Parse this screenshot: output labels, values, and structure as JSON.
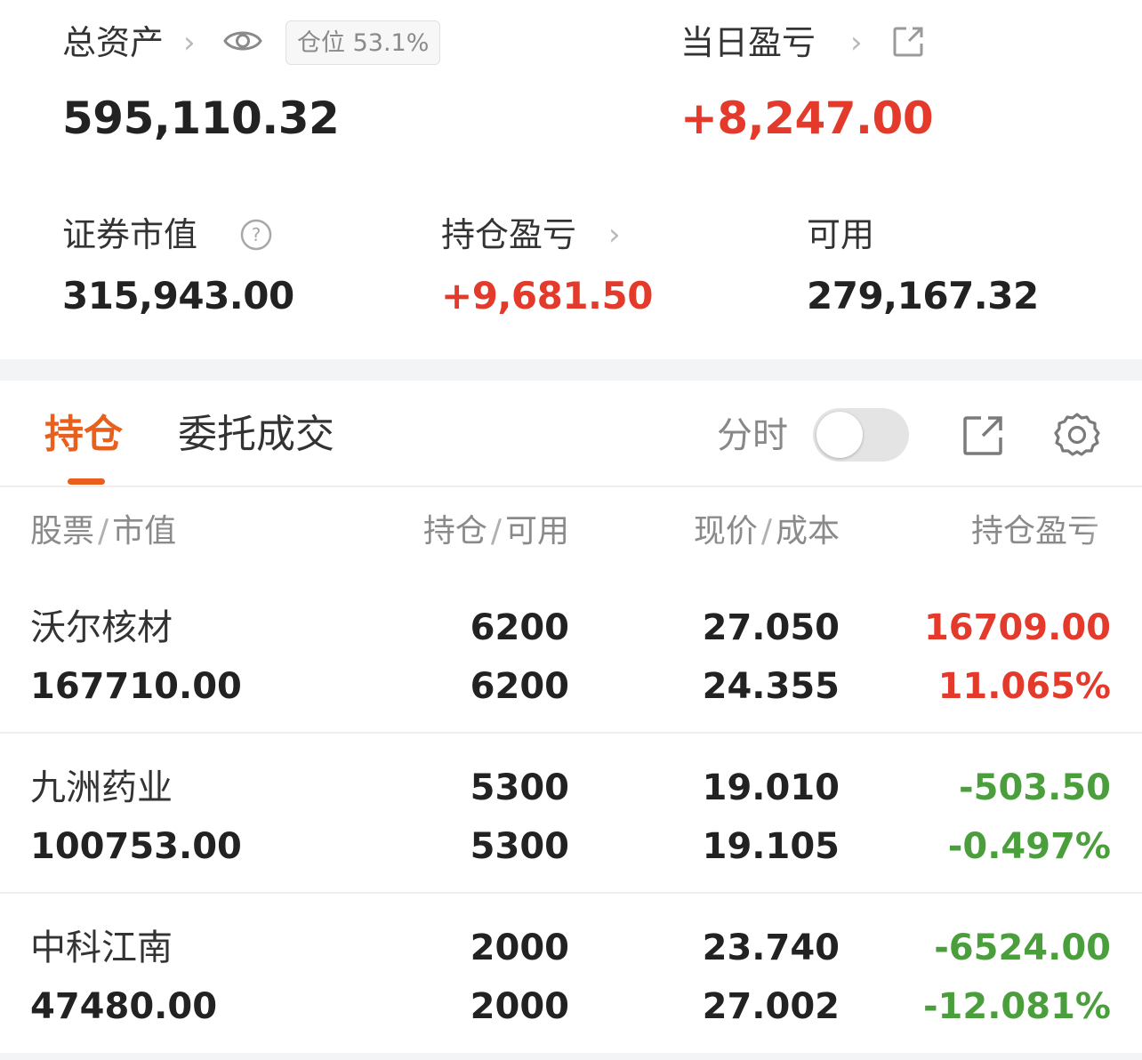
{
  "summary": {
    "total_assets_label": "总资产",
    "position_badge": "仓位 53.1%",
    "total_assets_value": "595,110.32",
    "daily_pnl_label": "当日盈亏",
    "daily_pnl_value": "+8,247.00",
    "market_value_label": "证券市值",
    "market_value_value": "315,943.00",
    "holding_pnl_label": "持仓盈亏",
    "holding_pnl_value": "+9,681.50",
    "available_label": "可用",
    "available_value": "279,167.32"
  },
  "tabs": {
    "holdings": "持仓",
    "orders": "委托成交",
    "intraday_label": "分时"
  },
  "table": {
    "headers": {
      "stock": "股票",
      "market_value": "市值",
      "position": "持仓",
      "available": "可用",
      "price": "现价",
      "cost": "成本",
      "pnl": "持仓盈亏"
    },
    "rows": [
      {
        "name": "沃尔核材",
        "market_value": "167710.00",
        "position": "6200",
        "available": "6200",
        "price": "27.050",
        "cost": "24.355",
        "pnl": "16709.00",
        "pnl_pct": "11.065%",
        "trend": "up"
      },
      {
        "name": "九洲药业",
        "market_value": "100753.00",
        "position": "5300",
        "available": "5300",
        "price": "19.010",
        "cost": "19.105",
        "pnl": "-503.50",
        "pnl_pct": "-0.497%",
        "trend": "down"
      },
      {
        "name": "中科江南",
        "market_value": "47480.00",
        "position": "2000",
        "available": "2000",
        "price": "23.740",
        "cost": "27.002",
        "pnl": "-6524.00",
        "pnl_pct": "-12.081%",
        "trend": "down"
      }
    ]
  },
  "colors": {
    "up": "#e33a2c",
    "down": "#4a9e3c",
    "accent": "#e8601c"
  }
}
